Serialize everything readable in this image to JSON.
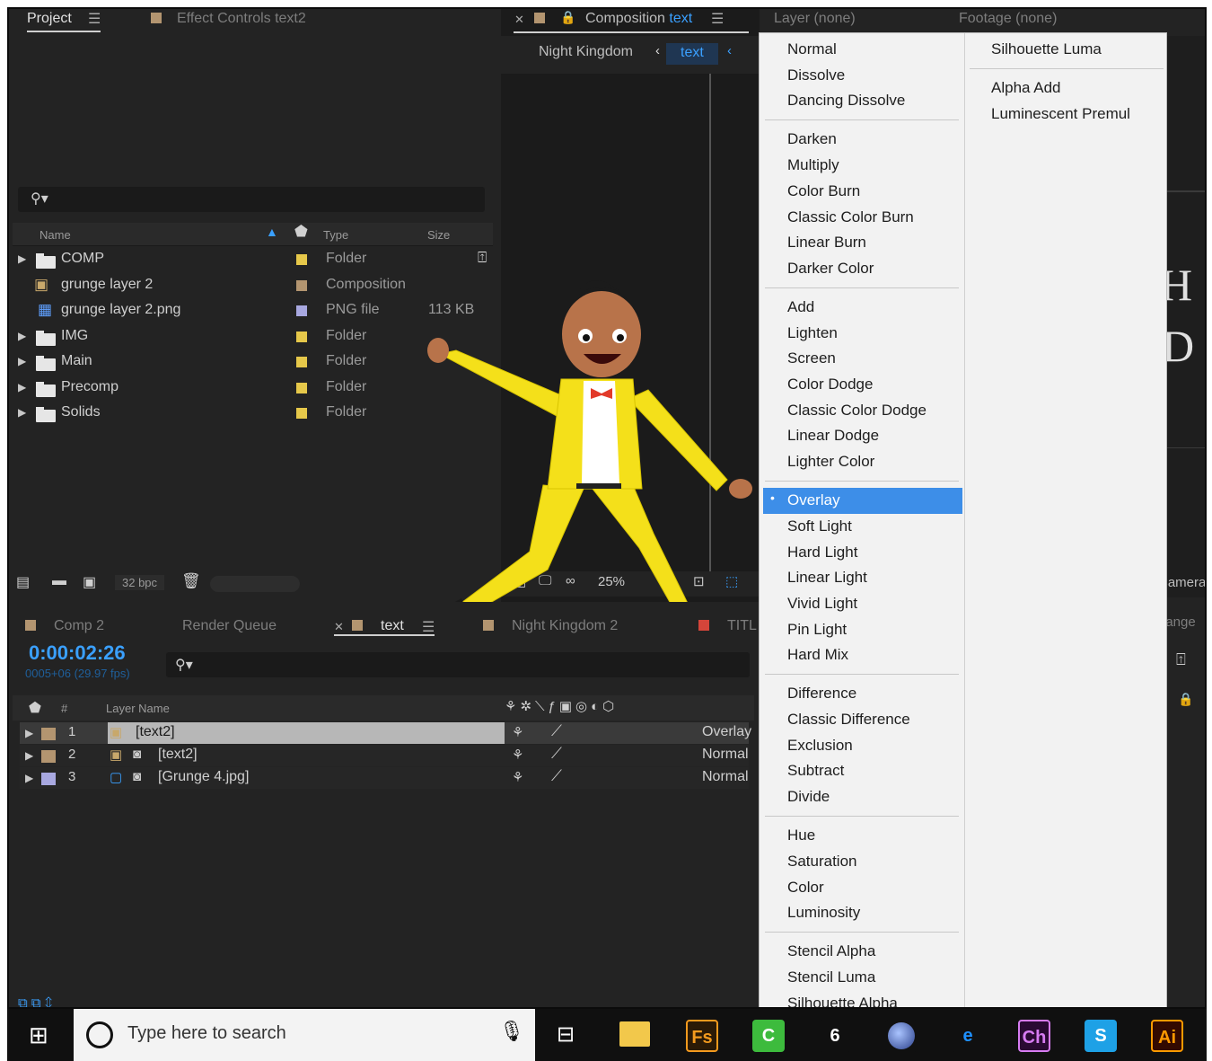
{
  "project_panel": {
    "tab_project": "Project",
    "tab_effect_controls": "Effect Controls text2",
    "columns": {
      "name": "Name",
      "type": "Type",
      "size": "Size"
    },
    "items": [
      {
        "name": "COMP",
        "type": "Folder",
        "size": "",
        "swatch": "#e6c84a",
        "kind": "folder"
      },
      {
        "name": "grunge layer 2",
        "type": "Composition",
        "size": "",
        "swatch": "#b39570",
        "kind": "comp"
      },
      {
        "name": "grunge layer 2.png",
        "type": "PNG file",
        "size": "113 KB",
        "swatch": "#a8a8e0",
        "kind": "png"
      },
      {
        "name": "IMG",
        "type": "Folder",
        "size": "",
        "swatch": "#e6c84a",
        "kind": "folder"
      },
      {
        "name": "Main",
        "type": "Folder",
        "size": "",
        "swatch": "#e6c84a",
        "kind": "folder"
      },
      {
        "name": "Precomp",
        "type": "Folder",
        "size": "",
        "swatch": "#e6c84a",
        "kind": "folder"
      },
      {
        "name": "Solids",
        "type": "Folder",
        "size": "",
        "swatch": "#e6c84a",
        "kind": "folder"
      }
    ],
    "bpc": "32 bpc"
  },
  "composition_panel": {
    "tab_label": "Composition",
    "tab_name": "text",
    "breadcrumb_1": "Night Kingdom",
    "breadcrumb_2": "text",
    "zoom": "25%",
    "right_tab_layer": "Layer  (none)",
    "right_tab_footage": "Footage  (none)",
    "camera": "Camera",
    "change": "hange",
    "overlay_text_1": "H",
    "overlay_text_2": "D"
  },
  "timeline": {
    "tabs": [
      "Comp 2",
      "Render Queue",
      "text",
      "Night Kingdom 2",
      "TITL"
    ],
    "timecode": "0:00:02:26",
    "frames": "0005+06 (29.97 fps)",
    "col_num": "#",
    "col_layer_name": "Layer Name",
    "layers": [
      {
        "num": "1",
        "name": "[text2]",
        "mode": "Overlay",
        "swatch": "#b39570"
      },
      {
        "num": "2",
        "name": "[text2]",
        "mode": "Normal",
        "swatch": "#b39570"
      },
      {
        "num": "3",
        "name": "[Grunge 4.jpg]",
        "mode": "Normal",
        "swatch": "#a8a8e0"
      }
    ]
  },
  "blend_menu": {
    "col1": [
      [
        "Normal",
        "Dissolve",
        "Dancing Dissolve"
      ],
      [
        "Darken",
        "Multiply",
        "Color Burn",
        "Classic Color Burn",
        "Linear Burn",
        "Darker Color"
      ],
      [
        "Add",
        "Lighten",
        "Screen",
        "Color Dodge",
        "Classic Color Dodge",
        "Linear Dodge",
        "Lighter Color"
      ],
      [
        "Overlay",
        "Soft Light",
        "Hard Light",
        "Linear Light",
        "Vivid Light",
        "Pin Light",
        "Hard Mix"
      ],
      [
        "Difference",
        "Classic Difference",
        "Exclusion",
        "Subtract",
        "Divide"
      ],
      [
        "Hue",
        "Saturation",
        "Color",
        "Luminosity"
      ],
      [
        "Stencil Alpha",
        "Stencil Luma",
        "Silhouette Alpha"
      ]
    ],
    "col2": [
      [
        "Silhouette Luma"
      ],
      [
        "Alpha Add",
        "Luminescent Premul"
      ]
    ],
    "selected": "Overlay",
    "selected_color": "#3d8ee8"
  },
  "taskbar": {
    "search_placeholder": "Type here to search",
    "apps": [
      {
        "label": "Fs",
        "icon": "fuse-icon",
        "bg": "#2b1a06",
        "fg": "#f39a1e"
      },
      {
        "label": "C",
        "icon": "camtasia-icon",
        "bg": "#3dbb3d",
        "fg": "#ffffff"
      },
      {
        "label": "6",
        "icon": "cinema-4d-flame-icon",
        "bg": "#101010",
        "fg": "#ffffff"
      },
      {
        "label": "",
        "icon": "cinema-4d-icon",
        "bg": "#101010",
        "fg": "#ffffff"
      },
      {
        "label": "e",
        "icon": "edge-icon",
        "bg": "#101010",
        "fg": "#1e90ff"
      },
      {
        "label": "Ch",
        "icon": "character-animator-icon",
        "bg": "#2a0a33",
        "fg": "#d77cf2"
      },
      {
        "label": "S",
        "icon": "skype-icon",
        "bg": "#1ea1e6",
        "fg": "#ffffff"
      },
      {
        "label": "Ai",
        "icon": "illustrator-icon",
        "bg": "#330a00",
        "fg": "#ff9a00"
      }
    ]
  }
}
